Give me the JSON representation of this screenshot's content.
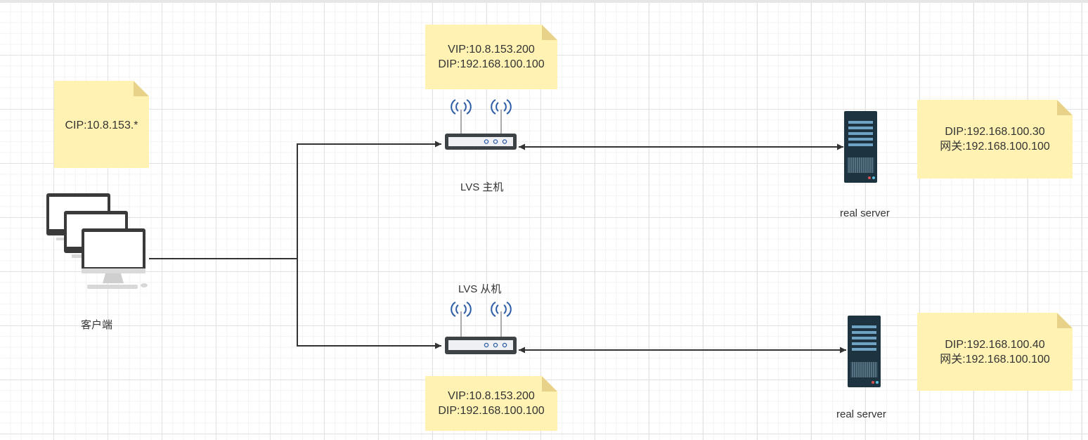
{
  "client": {
    "label": "客户端",
    "note": [
      "CIP:10.8.153.*"
    ]
  },
  "lvs_master": {
    "label": "LVS 主机",
    "note": [
      "VIP:10.8.153.200",
      "DIP:192.168.100.100"
    ]
  },
  "lvs_backup": {
    "label": "LVS 从机",
    "note": [
      "VIP:10.8.153.200",
      "DIP:192.168.100.100"
    ]
  },
  "real_server_1": {
    "label": "real server",
    "note": [
      "DIP:192.168.100.30",
      "网关:192.168.100.100"
    ]
  },
  "real_server_2": {
    "label": "real server",
    "note": [
      "DIP:192.168.100.40",
      "网关:192.168.100.100"
    ]
  },
  "colors": {
    "note_fill": "#fff2b3",
    "note_fold": "#e8d28a",
    "line": "#333333",
    "server_body": "#1e3340",
    "wifi_wave": "#2f5ea8"
  }
}
